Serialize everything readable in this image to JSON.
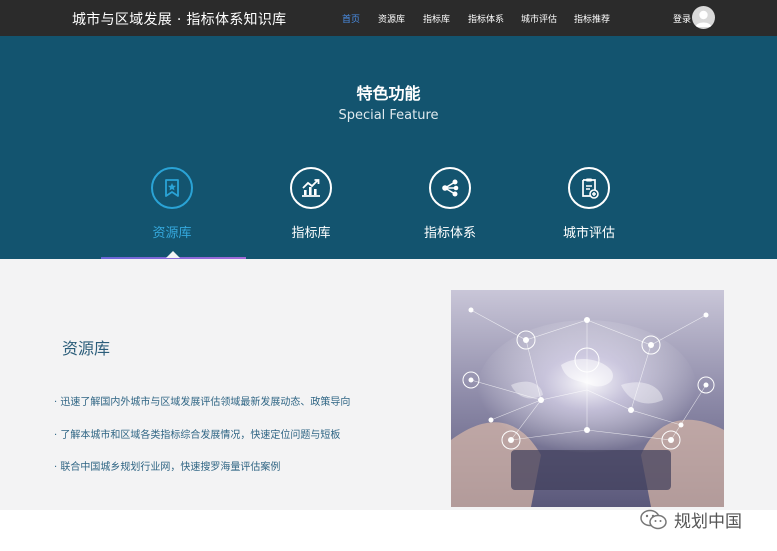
{
  "header": {
    "site_title": "城市与区域发展 · 指标体系知识库",
    "nav": [
      {
        "label": "首页",
        "active": true
      },
      {
        "label": "资源库"
      },
      {
        "label": "指标库"
      },
      {
        "label": "指标体系"
      },
      {
        "label": "城市评估"
      },
      {
        "label": "指标推荐"
      }
    ],
    "login_label": "登录"
  },
  "feature": {
    "title": "特色功能",
    "subtitle": "Special Feature",
    "items": [
      {
        "label": "资源库",
        "icon": "bookmark-star-icon",
        "active": true
      },
      {
        "label": "指标库",
        "icon": "chart-trend-icon"
      },
      {
        "label": "指标体系",
        "icon": "share-nodes-icon"
      },
      {
        "label": "城市评估",
        "icon": "clipboard-plus-icon"
      }
    ]
  },
  "content": {
    "heading": "资源库",
    "bullets": [
      "迅速了解国内外城市与区域发展评估领域最新发展动态、政策导向",
      "了解本城市和区域各类指标综合发展情况，快速定位问题与短板",
      "联合中国城乡规划行业网，快速搜罗海量评估案例"
    ]
  },
  "watermark": {
    "text": "规划中国",
    "icon": "wechat-icon"
  },
  "colors": {
    "topbar": "#2b2b2b",
    "feature_band": "#13546f",
    "accent": "#2aa3d6",
    "nav_active": "#4a8fe8"
  }
}
